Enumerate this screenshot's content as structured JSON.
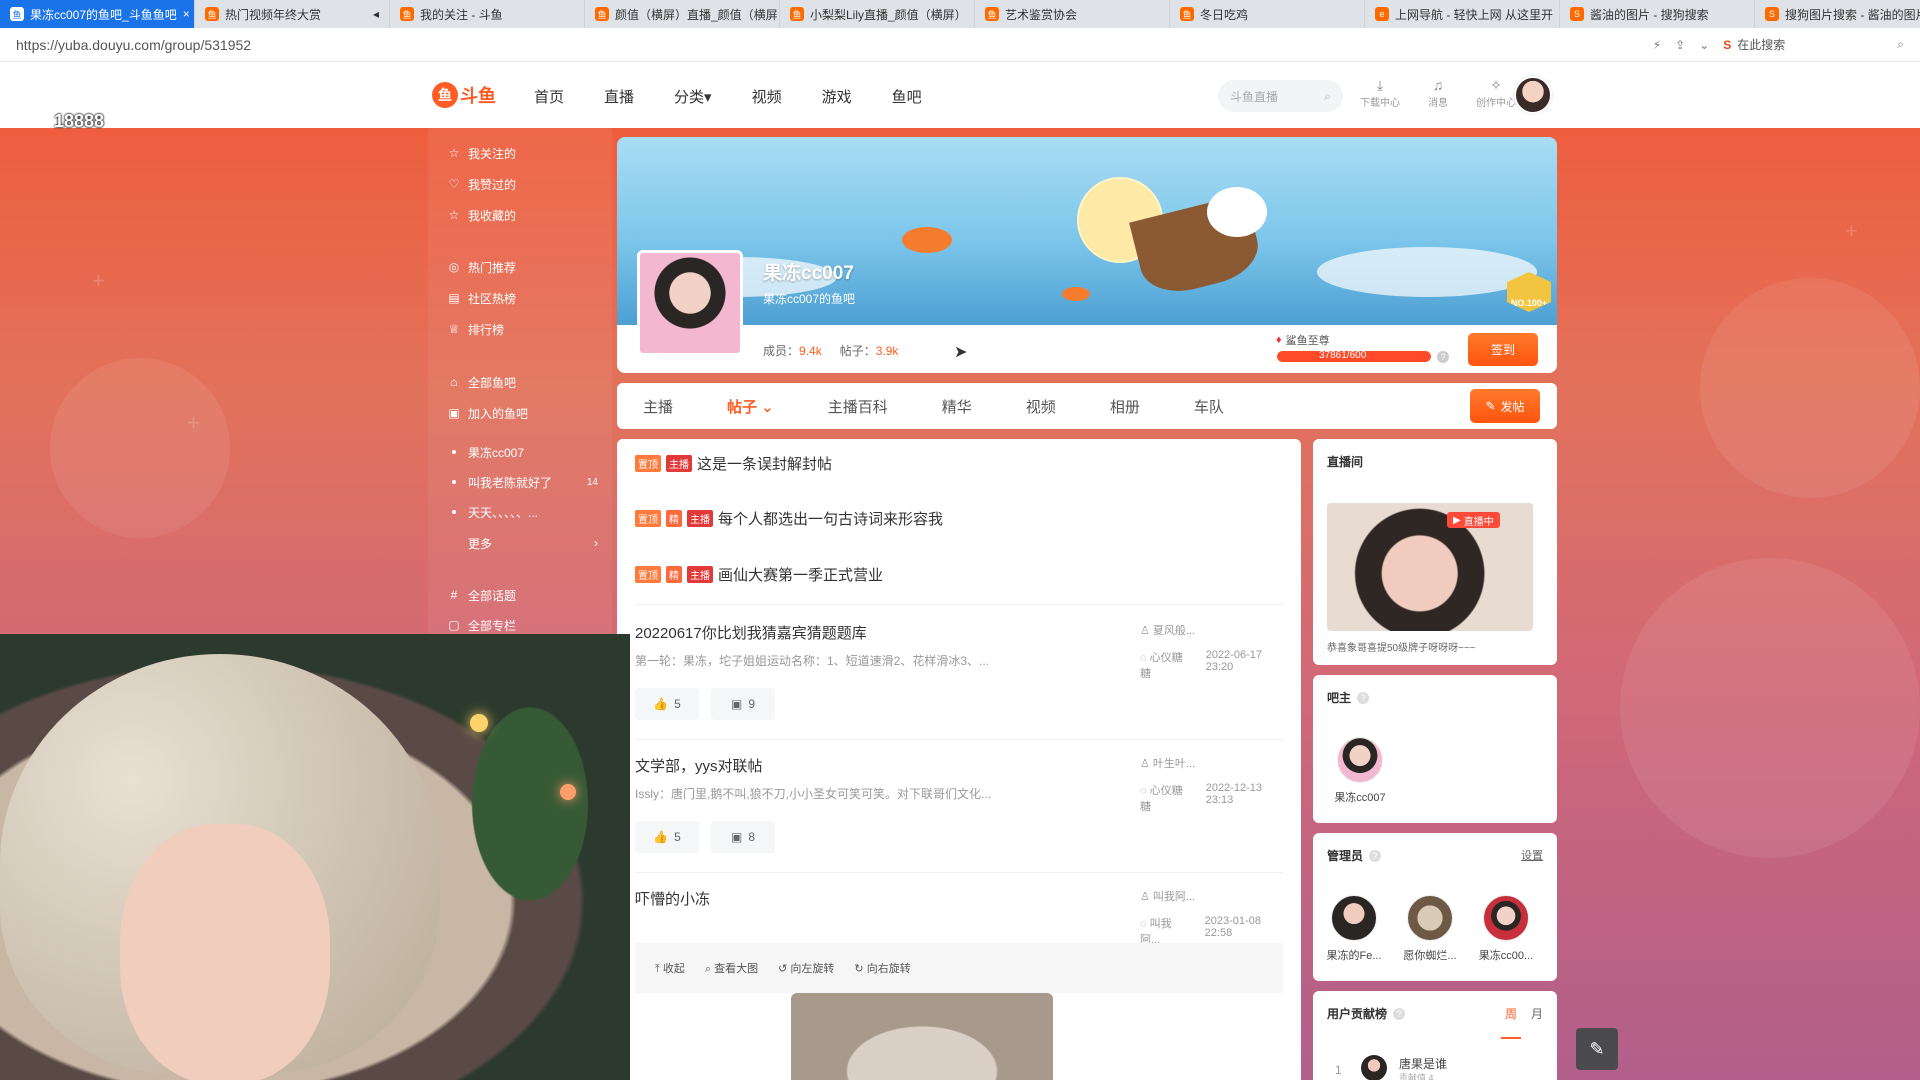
{
  "browser": {
    "tabs": [
      {
        "title": "果冻cc007的鱼吧_斗鱼鱼吧",
        "active": true,
        "close": "×",
        "icon": "douyu-icon"
      },
      {
        "title": "热门视频年终大赏",
        "active": false,
        "close": "◂",
        "icon": "douyu-icon"
      },
      {
        "title": "我的关注 - 斗鱼",
        "active": false,
        "close": "",
        "icon": "douyu-icon"
      },
      {
        "title": "颜值（横屏）直播_颜值（横屏",
        "active": false,
        "close": "",
        "icon": "douyu-icon"
      },
      {
        "title": "小梨梨Lily直播_颜值（横屏）",
        "active": false,
        "close": "",
        "icon": "douyu-icon"
      },
      {
        "title": "艺术鉴赏协会",
        "active": false,
        "close": "",
        "icon": "douyu-icon"
      },
      {
        "title": "冬日吃鸡",
        "active": false,
        "close": "",
        "icon": "douyu-icon"
      },
      {
        "title": "上网导航 - 轻快上网 从这里开",
        "active": false,
        "close": "",
        "icon": "e-icon"
      },
      {
        "title": "酱油的图片 - 搜狗搜索",
        "active": false,
        "close": "",
        "icon": "sogou-icon"
      },
      {
        "title": "搜狗图片搜索 - 酱油的图片",
        "active": false,
        "close": "",
        "icon": "sogou-icon"
      }
    ],
    "url": "https://yuba.douyu.com/group/531952",
    "search_placeholder": "在此搜索"
  },
  "live_id": "18888",
  "header": {
    "logo_text": "斗鱼",
    "nav": [
      "首页",
      "直播",
      "分类▾",
      "视频",
      "游戏",
      "鱼吧"
    ],
    "search_placeholder": "斗鱼直播",
    "icons": [
      {
        "label": "下载中心",
        "icon": "download-icon",
        "glyph": "⤓"
      },
      {
        "label": "消息",
        "icon": "bell-icon",
        "glyph": "🔔"
      },
      {
        "label": "创作中心",
        "icon": "bulb-icon",
        "glyph": "💡"
      }
    ]
  },
  "sidebar": {
    "group1": [
      {
        "label": "我关注的",
        "icon": "star-icon",
        "glyph": "☆"
      },
      {
        "label": "我赞过的",
        "icon": "thumb-icon",
        "glyph": "👍"
      },
      {
        "label": "我收藏的",
        "icon": "star-icon",
        "glyph": "☆"
      }
    ],
    "group2": [
      {
        "label": "热门推荐",
        "icon": "fire-icon",
        "glyph": "◎"
      },
      {
        "label": "社区热榜",
        "icon": "chart-icon",
        "glyph": "▤"
      },
      {
        "label": "排行榜",
        "icon": "trophy-icon",
        "glyph": "♕"
      }
    ],
    "group3": [
      {
        "label": "全部鱼吧",
        "icon": "home-icon",
        "glyph": "⌂"
      },
      {
        "label": "加入的鱼吧",
        "icon": "join-icon",
        "glyph": "▣"
      }
    ],
    "joined": [
      {
        "label": "果冻cc007",
        "badge": ""
      },
      {
        "label": "叫我老陈就好了",
        "badge": "14"
      },
      {
        "label": "天天、、、、、...",
        "badge": ""
      }
    ],
    "more": "更多",
    "group4": [
      {
        "label": "全部话题",
        "icon": "hash-icon",
        "glyph": "#"
      },
      {
        "label": "全部专栏",
        "icon": "column-icon",
        "glyph": "▢"
      }
    ]
  },
  "group": {
    "name": "果冻cc007",
    "subtitle": "果冻cc007的鱼吧",
    "members_label": "成员：",
    "members": "9.4k",
    "posts_label": "帖子：",
    "posts": "3.9k",
    "level_name": "鲨鱼至尊",
    "level_progress": "37861/600",
    "level_fraction": 1.0,
    "rank_badge": "NO.100+",
    "sign_label": "签到"
  },
  "tabs": {
    "items": [
      "主播",
      "帖子 ⌄",
      "主播百科",
      "精华",
      "视频",
      "相册",
      "车队"
    ],
    "active_index": 1,
    "post_button": "发帖"
  },
  "pinned": [
    {
      "tags": [
        "置顶",
        "主播"
      ],
      "title": "这是一条误封解封帖"
    },
    {
      "tags": [
        "置顶",
        "精",
        "主播"
      ],
      "title": "每个人都选出一句古诗词来形容我"
    },
    {
      "tags": [
        "置顶",
        "精",
        "主播"
      ],
      "title": "画仙大赛第一季正式营业"
    }
  ],
  "posts": [
    {
      "title": "20220617你比划我猜嘉宾猜题题库",
      "excerpt": "第一轮：果冻，坨子姐姐运动名称：1、短道速滑2、花样滑冰3、...",
      "author": "夏风般...",
      "last_reply": "心仪糖糖",
      "time": "2022-06-17 23:20",
      "likes": "5",
      "comments": "9"
    },
    {
      "title": "文学部，yys对联帖",
      "excerpt": "Issly：唐门里,鹅不叫,狼不刀,小小圣女可笑可笑。对下联哥们文化...",
      "author": "叶生叶...",
      "last_reply": "心仪糖糖",
      "time": "2022-12-13 23:13",
      "likes": "5",
      "comments": "8"
    },
    {
      "title": "吓懵的小冻",
      "excerpt": "",
      "author": "叫我阿...",
      "last_reply": "叫我阿...",
      "time": "2023-01-08 22:58",
      "likes": "",
      "comments": ""
    }
  ],
  "image_tools": [
    "收起",
    "查看大图",
    "向左旋转",
    "向右旋转"
  ],
  "right": {
    "live_title": "直播间",
    "live_badge": "直播中",
    "live_caption": "恭喜象哥喜提50级牌子呀呀呀~~~",
    "owner_title": "吧主",
    "owner_name": "果冻cc007",
    "admin_title": "管理员",
    "admin_settings": "设置",
    "admins": [
      "果冻的Fe...",
      "愿你蜘烂...",
      "果冻cc00..."
    ],
    "contrib_title": "用户贡献榜",
    "contrib_tabs": [
      "周",
      "月"
    ],
    "contrib_first": {
      "rank": "1",
      "name": "唐果是谁",
      "sub": "贡献值 4"
    }
  },
  "colors": {
    "accent": "#ff5d23",
    "tab_active": "#1a73e8"
  }
}
